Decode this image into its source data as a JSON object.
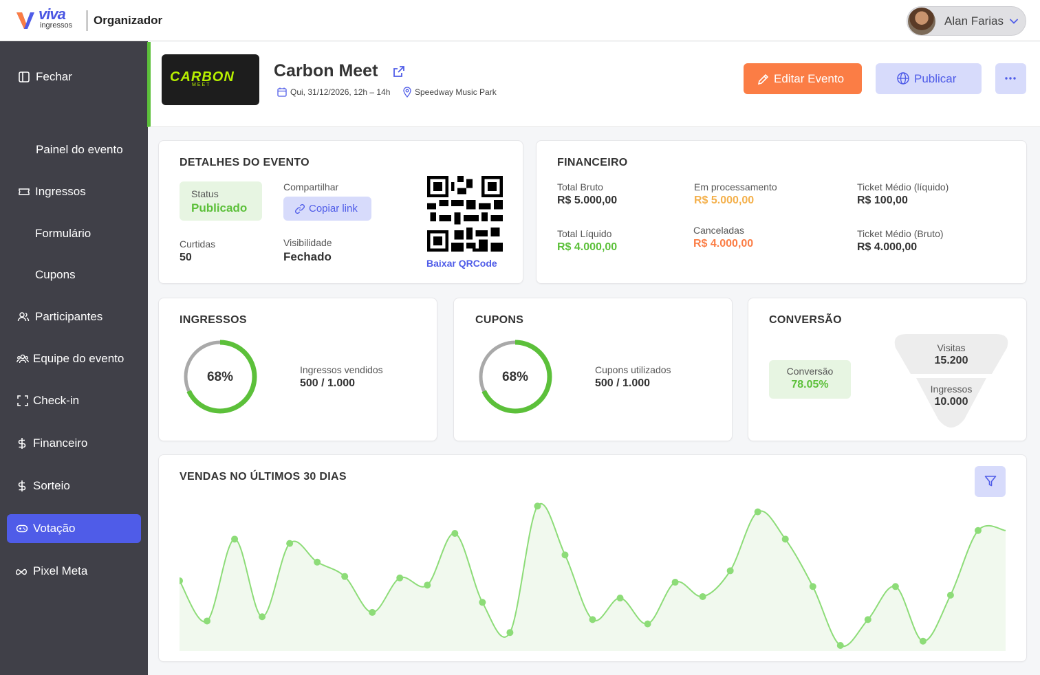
{
  "header": {
    "logo_text": "viva",
    "logo_sub": "ingressos",
    "org_title": "Organizador",
    "user_name": "Alan Farias"
  },
  "sidebar": {
    "items": [
      {
        "label": "Fechar",
        "icon": "panel-icon"
      },
      {
        "label": "Painel do evento",
        "icon": ""
      },
      {
        "label": "Ingressos",
        "icon": "ticket-icon"
      },
      {
        "label": "Formulário",
        "icon": ""
      },
      {
        "label": "Cupons",
        "icon": ""
      },
      {
        "label": "Participantes",
        "icon": "users-icon"
      },
      {
        "label": "Equipe do evento",
        "icon": "team-icon"
      },
      {
        "label": "Check-in",
        "icon": "scan-icon"
      },
      {
        "label": "Financeiro",
        "icon": "dollar-icon"
      },
      {
        "label": "Sorteio",
        "icon": "dollar-icon"
      },
      {
        "label": "Votação",
        "icon": "gamepad-icon",
        "active": true
      },
      {
        "label": "Pixel Meta",
        "icon": "meta-icon"
      }
    ]
  },
  "event": {
    "logo_text": "CARBON",
    "logo_sub": "MEET",
    "title": "Carbon Meet",
    "date": "Qui, 31/12/2026, 12h – 14h",
    "location": "Speedway Music Park",
    "edit_label": "Editar Evento",
    "publish_label": "Publicar"
  },
  "details": {
    "title": "DETALHES DO EVENTO",
    "status_label": "Status",
    "status_value": "Publicado",
    "share_label": "Compartilhar",
    "copy_label": "Copiar link",
    "likes_label": "Curtidas",
    "likes_value": "50",
    "visibility_label": "Visibilidade",
    "visibility_value": "Fechado",
    "qr_link": "Baixar QRCode"
  },
  "finance": {
    "title": "FINANCEIRO",
    "gross_label": "Total Bruto",
    "gross_value": "R$ 5.000,00",
    "processing_label": "Em processamento",
    "processing_value": "R$ 5.000,00",
    "avg_net_label": "Ticket Médio (líquido)",
    "avg_net_value": "R$ 100,00",
    "net_label": "Total Líquido",
    "net_value": "R$ 4.000,00",
    "canceled_label": "Canceladas",
    "canceled_value": "R$ 4.000,00",
    "avg_gross_label": "Ticket Médio (Bruto)",
    "avg_gross_value": "R$ 4.000,00",
    "colors": {
      "positive": "#5cc03a",
      "pending": "#f4b04b",
      "negative": "#fb7d45"
    }
  },
  "tickets": {
    "title": "INGRESSOS",
    "percent_text": "68%",
    "percent": 0.68,
    "sold_label": "Ingressos vendidos",
    "sold_value": "500 / 1.000"
  },
  "coupons": {
    "title": "CUPONS",
    "percent_text": "68%",
    "percent": 0.68,
    "used_label": "Cupons utilizados",
    "used_value": "500 / 1.000"
  },
  "conversion": {
    "title": "CONVERSÃO",
    "conv_label": "Conversão",
    "conv_value": "78.05%",
    "visits_label": "Visitas",
    "visits_value": "15.200",
    "tickets_label": "Ingressos",
    "tickets_value": "10.000"
  },
  "sales_chart": {
    "title": "VENDAS NO ÚLTIMOS 30 DIAS"
  },
  "chart_data": {
    "type": "area",
    "title": "VENDAS NO ÚLTIMOS 30 DIAS",
    "values": [
      45,
      17,
      74,
      20,
      71,
      58,
      48,
      23,
      47,
      42,
      78,
      30,
      9,
      97,
      63,
      18,
      33,
      15,
      44,
      34,
      52,
      93,
      74,
      41,
      0,
      18,
      41,
      3,
      35,
      80
    ],
    "end_value": 80,
    "ylim": [
      0,
      100
    ],
    "color": "#8ddc78",
    "fill": "#f1f9ee"
  }
}
